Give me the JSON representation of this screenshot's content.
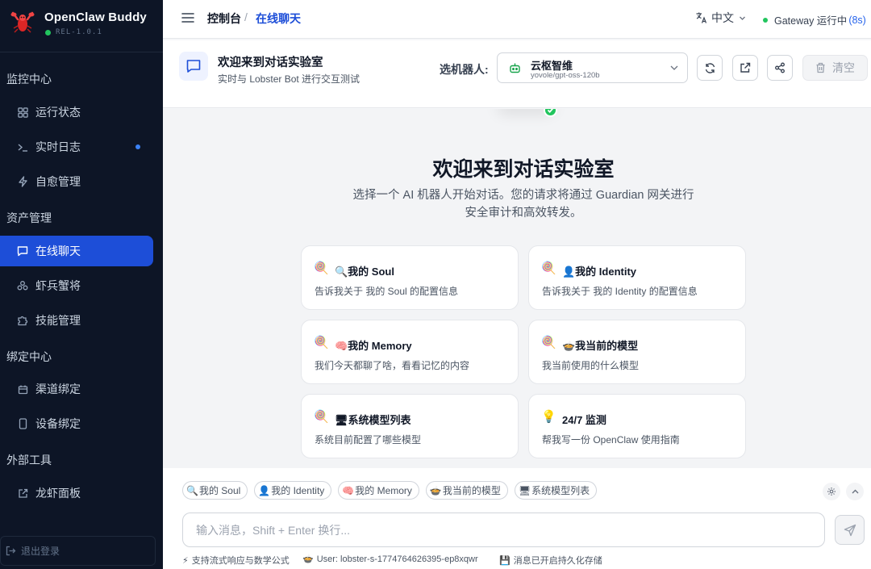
{
  "app": {
    "brand": "OpenClaw Buddy",
    "version": "REL-1.0.1"
  },
  "sidebar": {
    "sections": [
      {
        "label": "监控中心",
        "items": [
          {
            "label": "运行状态",
            "icon": "grid-icon"
          },
          {
            "label": "实时日志",
            "icon": "terminal-icon"
          },
          {
            "label": "自愈管理",
            "icon": "bolt-icon"
          }
        ]
      },
      {
        "label": "资产管理",
        "items": [
          {
            "label": "在线聊天",
            "icon": "chat-icon"
          },
          {
            "label": "虾兵蟹将",
            "icon": "team-icon"
          },
          {
            "label": "技能管理",
            "icon": "puzzle-icon"
          }
        ]
      },
      {
        "label": "绑定中心",
        "items": [
          {
            "label": "渠道绑定",
            "icon": "calendar-icon"
          },
          {
            "label": "设备绑定",
            "icon": "phone-icon"
          }
        ]
      },
      {
        "label": "外部工具",
        "items": [
          {
            "label": "龙虾面板",
            "icon": "external-link-icon"
          }
        ]
      }
    ],
    "logout": "退出登录"
  },
  "topbar": {
    "breadcrumb": [
      "控制台",
      "/",
      "在线聊天"
    ],
    "language": "中文",
    "gateway_label": "Gateway 运行中",
    "gateway_time": "(8s)"
  },
  "chat_header": {
    "title": "欢迎来到对话实验室",
    "subtitle": "实时与 Lobster Bot 进行交互测试",
    "robot_label": "选机器人:",
    "robot_name": "云枢智维",
    "robot_model": "yovole/gpt-oss-120b",
    "clear": "清空"
  },
  "welcome": {
    "title": "欢迎来到对话实验室",
    "subtitle": "选择一个 AI 机器人开始对话。您的请求将通过 Guardian 网关进行安全审计和高效转发。",
    "cards": [
      {
        "icon": "🍭",
        "title": "🔍我的 Soul",
        "desc": "告诉我关于 我的 Soul 的配置信息"
      },
      {
        "icon": "🍭",
        "title": "👤我的 Identity",
        "desc": "告诉我关于 我的 Identity 的配置信息"
      },
      {
        "icon": "🍭",
        "title": "🧠我的 Memory",
        "desc": "我们今天都聊了啥，看看记忆的内容"
      },
      {
        "icon": "🍭",
        "title": "🍲我当前的模型",
        "desc": "我当前使用的什么模型"
      },
      {
        "icon": "🍭",
        "title": "🖥系统模型列表",
        "desc": "系统目前配置了哪些模型"
      },
      {
        "icon": "💡",
        "title": "24/7 监测",
        "desc": "帮我写一份 OpenClaw 使用指南"
      }
    ]
  },
  "composer": {
    "chips": [
      {
        "emoji": "🔍",
        "text": "我的 Soul"
      },
      {
        "emoji": "👤",
        "text": "我的 Identity"
      },
      {
        "emoji": "🧠",
        "text": "我的 Memory"
      },
      {
        "emoji": "🍲",
        "text": "我当前的模型"
      },
      {
        "emoji": "🖥",
        "text": "系统模型列表"
      }
    ],
    "placeholder": "输入消息，Shift + Enter 换行...",
    "value": "",
    "footer": [
      {
        "emoji": "⚡",
        "text": "支持流式响应与数学公式"
      },
      {
        "emoji": "🍲",
        "text": "User: lobster-s-1774764626395-ep8xqwr"
      },
      {
        "emoji": "💾",
        "text": "消息已开启持久化存储"
      }
    ]
  },
  "colors": {
    "sidebar_bg": "#0d1526",
    "accent": "#1d4ed8",
    "status_green": "#22c55e"
  }
}
